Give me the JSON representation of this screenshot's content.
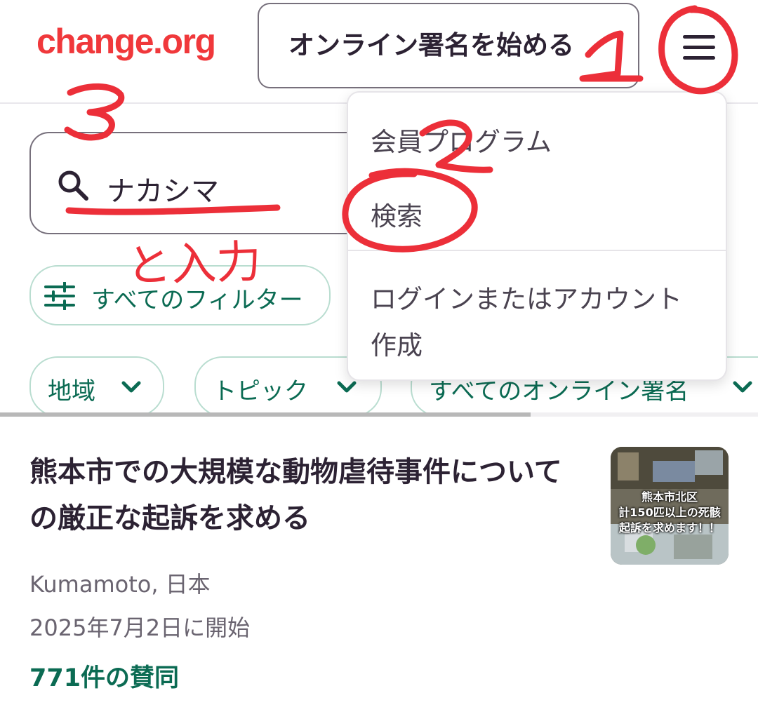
{
  "header": {
    "logo": "change.org",
    "start_petition": "オンライン署名を始める",
    "menu_icon": "hamburger-menu-icon"
  },
  "search": {
    "value": "ナカシマ",
    "icon": "search-icon"
  },
  "filters": {
    "all_filters": "すべてのフィルター",
    "region": "地域",
    "topic": "トピック",
    "all_petitions": "すべてのオンライン署名"
  },
  "dropdown_menu": {
    "items": [
      {
        "label": "会員プログラム"
      },
      {
        "label": "検索"
      },
      {
        "label": "ログインまたはアカウント作成"
      }
    ]
  },
  "result": {
    "title": "熊本市での大規模な動物虐待事件についての厳正な起訴を求める",
    "location": "Kumamoto, 日本",
    "started": "2025年7月2日に開始",
    "supporters": "771件の賛同",
    "thumbnail_caption": [
      "熊本市北区",
      "計150匹以上の死骸",
      "起訴を求めます！！"
    ]
  },
  "annotations": {
    "handwritten_text": "と入力",
    "marker_color": "#ec2f39"
  },
  "colors": {
    "brand": "#f0383b",
    "accent_green": "#0b6b53",
    "text": "#2c2233"
  }
}
